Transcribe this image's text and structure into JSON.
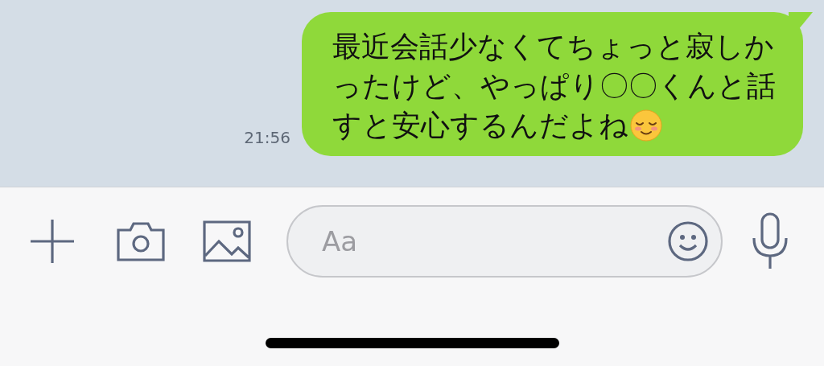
{
  "message": {
    "lines": [
      "最近会話少なくてちょっと寂しか",
      "ったけど、やっぱり〇〇くんと話",
      "すと安心するんだよね"
    ],
    "time": "21:56"
  },
  "input": {
    "placeholder": "Aa"
  }
}
